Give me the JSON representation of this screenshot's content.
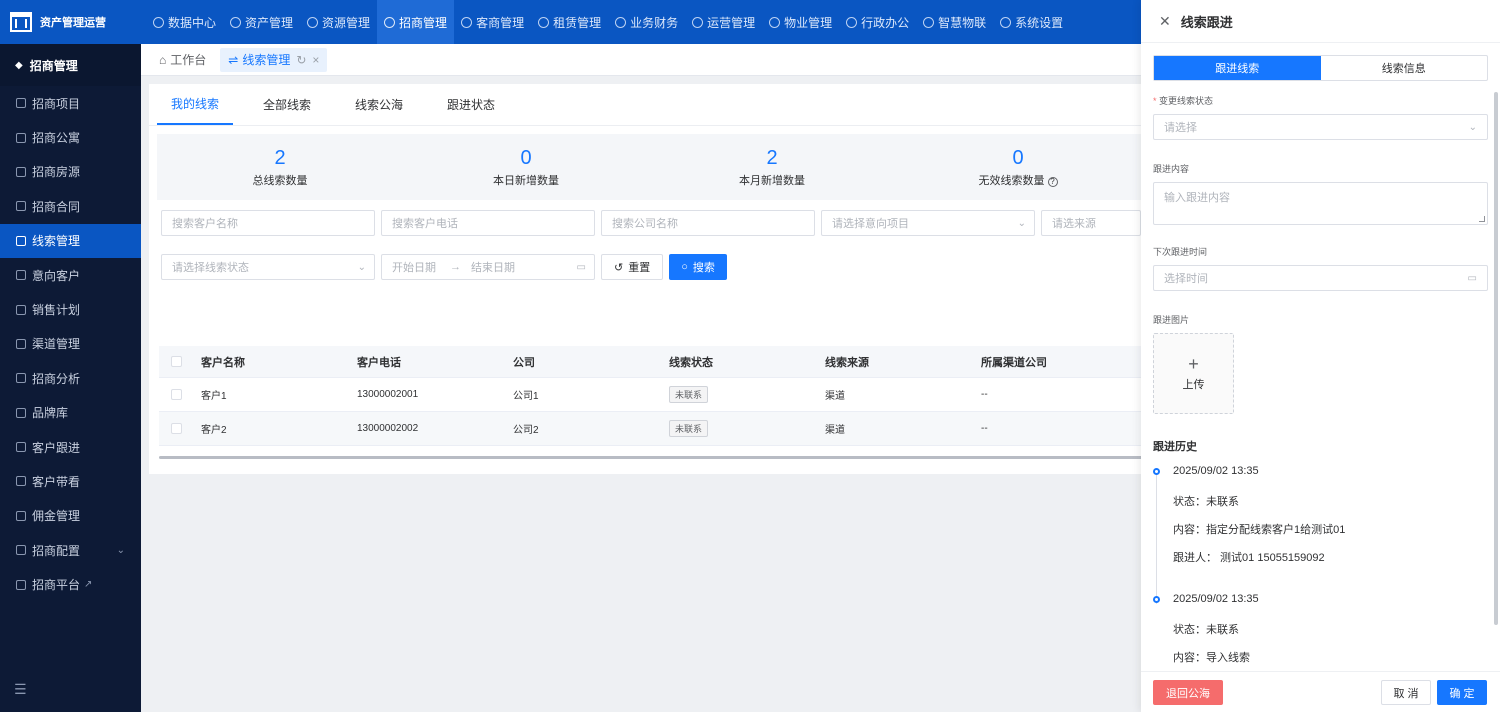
{
  "app": {
    "brand": "资产管理运营"
  },
  "topnav": [
    {
      "label": "数据中心"
    },
    {
      "label": "资产管理"
    },
    {
      "label": "资源管理"
    },
    {
      "label": "招商管理"
    },
    {
      "label": "客商管理"
    },
    {
      "label": "租赁管理"
    },
    {
      "label": "业务财务"
    },
    {
      "label": "运营管理"
    },
    {
      "label": "物业管理"
    },
    {
      "label": "行政办公"
    },
    {
      "label": "智慧物联"
    },
    {
      "label": "系统设置"
    }
  ],
  "sidebar": {
    "header": "招商管理",
    "items": [
      {
        "label": "招商项目"
      },
      {
        "label": "招商公寓"
      },
      {
        "label": "招商房源"
      },
      {
        "label": "招商合同"
      },
      {
        "label": "线索管理"
      },
      {
        "label": "意向客户"
      },
      {
        "label": "销售计划"
      },
      {
        "label": "渠道管理"
      },
      {
        "label": "招商分析"
      },
      {
        "label": "品牌库"
      },
      {
        "label": "客户跟进"
      },
      {
        "label": "客户带看"
      },
      {
        "label": "佣金管理"
      },
      {
        "label": "招商配置"
      },
      {
        "label": "招商平台"
      }
    ]
  },
  "pagetabs": {
    "workbench": "工作台",
    "current": "线索管理"
  },
  "subtabs": [
    "我的线索",
    "全部线索",
    "线索公海",
    "跟进状态"
  ],
  "stats": [
    {
      "value": "2",
      "label": "总线索数量"
    },
    {
      "value": "0",
      "label": "本日新增数量"
    },
    {
      "value": "2",
      "label": "本月新增数量"
    },
    {
      "value": "0",
      "label": "无效线索数量"
    }
  ],
  "filters": {
    "customer_name": "搜索客户名称",
    "customer_phone": "搜索客户电话",
    "company_name": "搜索公司名称",
    "intent_project": "请选择意向项目",
    "source": "请选来源",
    "lead_status": "请选择线索状态",
    "start_date": "开始日期",
    "range_sep": "→",
    "end_date": "结束日期",
    "reset": "重置",
    "search": "搜索"
  },
  "table": {
    "headers": [
      "客户名称",
      "客户电话",
      "公司",
      "线索状态",
      "线索来源",
      "所属渠道公司"
    ],
    "rows": [
      [
        "客户1",
        "13000002001",
        "公司1",
        "未联系",
        "渠道",
        "--"
      ],
      [
        "客户2",
        "13000002002",
        "公司2",
        "未联系",
        "渠道",
        "--"
      ]
    ]
  },
  "drawer": {
    "title": "线索跟进",
    "tabs": [
      "跟进线索",
      "线索信息"
    ],
    "status_label": "变更线索状态",
    "status_placeholder": "请选择",
    "content_label": "跟进内容",
    "content_placeholder": "输入跟进内容",
    "next_time_label": "下次跟进时间",
    "next_time_placeholder": "选择时间",
    "image_label": "跟进图片",
    "upload_label": "上传",
    "history_title": "跟进历史",
    "history": [
      {
        "time": "2025/09/02 13:35",
        "status": "状态：未联系",
        "content": "内容：指定分配线索客户1给测试01",
        "person": "跟进人：  测试01 15055159092"
      },
      {
        "time": "2025/09/02 13:35",
        "status": "状态：未联系",
        "content": "内容：导入线索"
      }
    ],
    "btn_return": "退回公海",
    "btn_cancel": "取 消",
    "btn_ok": "确 定"
  },
  "colors": {
    "primary": "#1677ff",
    "topbar": "#0a56c2",
    "sidebar": "#0d1a36",
    "danger": "#f56c6c"
  }
}
